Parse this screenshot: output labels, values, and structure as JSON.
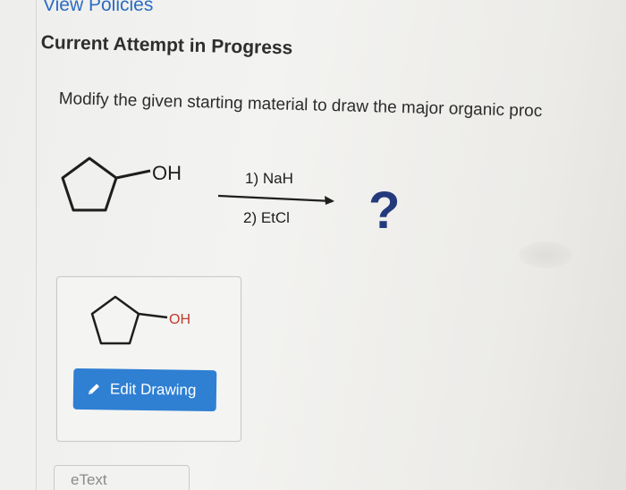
{
  "header": {
    "view_policies_link": "View Policies",
    "attempt_title": "Current Attempt in Progress"
  },
  "question": {
    "instruction": "Modify the given starting material to draw the major organic proc",
    "reactant_group": "OH",
    "reagent_step1": "1) NaH",
    "reagent_step2": "2) EtCl",
    "product_placeholder": "?"
  },
  "drawing_panel": {
    "molecule_group": "OH",
    "edit_button_label": "Edit Drawing"
  },
  "footer": {
    "etext_label": "eText"
  },
  "colors": {
    "link": "#2a6cc4",
    "button": "#2f7fd3",
    "question_mark": "#233a7c",
    "molecule_hydroxyl_panel": "#c0392b"
  },
  "icons": {
    "edit_button": "pencil-icon"
  }
}
